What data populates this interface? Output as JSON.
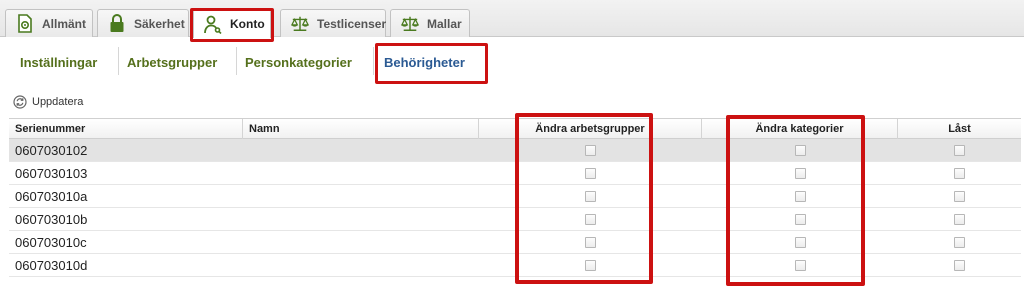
{
  "tabs": [
    {
      "label": "Allmänt",
      "icon": "document-gear-icon"
    },
    {
      "label": "Säkerhet",
      "icon": "padlock-icon"
    },
    {
      "label": "Konto",
      "icon": "person-key-icon",
      "active": true
    },
    {
      "label": "Testlicenser",
      "icon": "scales-icon"
    },
    {
      "label": "Mallar",
      "icon": "scales-icon"
    }
  ],
  "subnav": [
    {
      "label": "Inställningar"
    },
    {
      "label": "Arbetsgrupper"
    },
    {
      "label": "Personkategorier"
    },
    {
      "label": "Behörigheter",
      "active": true
    }
  ],
  "toolbar": {
    "refresh_label": "Uppdatera",
    "refresh_icon": "refresh-icon"
  },
  "table": {
    "columns": [
      "Serienummer",
      "Namn",
      "Ändra arbetsgrupper",
      "Ändra kategorier",
      "Låst"
    ],
    "rows": [
      {
        "serial": "0607030102",
        "name": "",
        "change_workgroups": false,
        "change_categories": false,
        "locked": false
      },
      {
        "serial": "0607030103",
        "name": "",
        "change_workgroups": false,
        "change_categories": false,
        "locked": false
      },
      {
        "serial": "060703010a",
        "name": "",
        "change_workgroups": false,
        "change_categories": false,
        "locked": false
      },
      {
        "serial": "060703010b",
        "name": "",
        "change_workgroups": false,
        "change_categories": false,
        "locked": false
      },
      {
        "serial": "060703010c",
        "name": "",
        "change_workgroups": false,
        "change_categories": false,
        "locked": false
      },
      {
        "serial": "060703010d",
        "name": "",
        "change_workgroups": false,
        "change_categories": false,
        "locked": false
      }
    ],
    "selected_row": 0
  },
  "colors": {
    "highlight_red": "#cc1111",
    "subnav_green": "#55701c",
    "subnav_active_blue": "#2b5a93",
    "icon_green": "#4a7a1f"
  }
}
